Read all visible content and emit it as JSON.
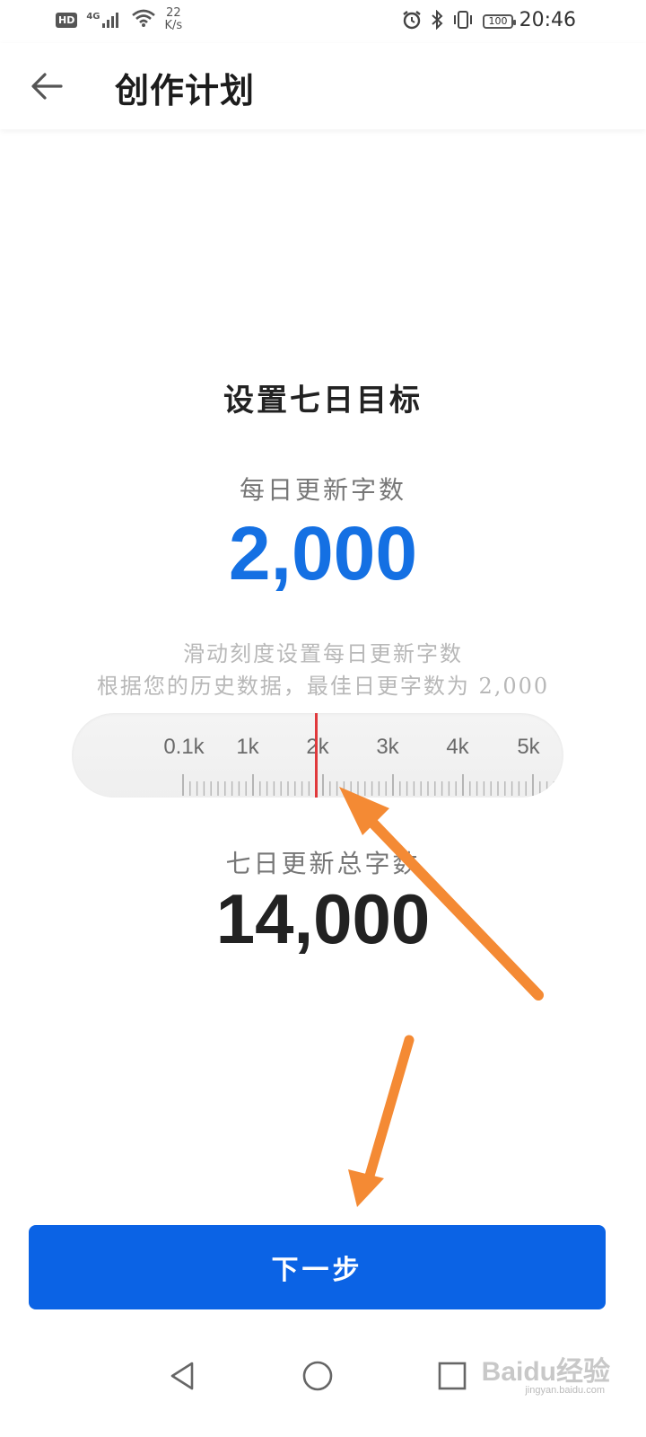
{
  "status_bar": {
    "hd": "HD",
    "network": "4G",
    "speed_value": "22",
    "speed_unit": "K/s",
    "battery": "100",
    "time": "20:46"
  },
  "header": {
    "title": "创作计划",
    "back_icon": "back-arrow-icon"
  },
  "main": {
    "goal_title": "设置七日目标",
    "daily_label": "每日更新字数",
    "daily_value": "2,000",
    "hint_line1": "滑动刻度设置每日更新字数",
    "hint_line2": "根据您的历史数据，最佳日更字数为 2,000",
    "total_label": "七日更新总字数",
    "total_value": "14,000"
  },
  "ruler": {
    "labels": [
      "0.1k",
      "1k",
      "2k",
      "3k",
      "4k",
      "5k"
    ],
    "selected": "2k",
    "indicator_color": "#e0393c"
  },
  "footer": {
    "next_label": "下一步"
  },
  "navbar": {
    "back_icon": "triangle-back-icon",
    "home_icon": "circle-home-icon",
    "recents_icon": "square-recents-icon"
  },
  "watermark": {
    "brand": "Baidu经验",
    "url": "jingyan.baidu.com"
  },
  "colors": {
    "accent": "#1470e3",
    "button": "#0b63e5",
    "annotation": "#f48a34"
  }
}
